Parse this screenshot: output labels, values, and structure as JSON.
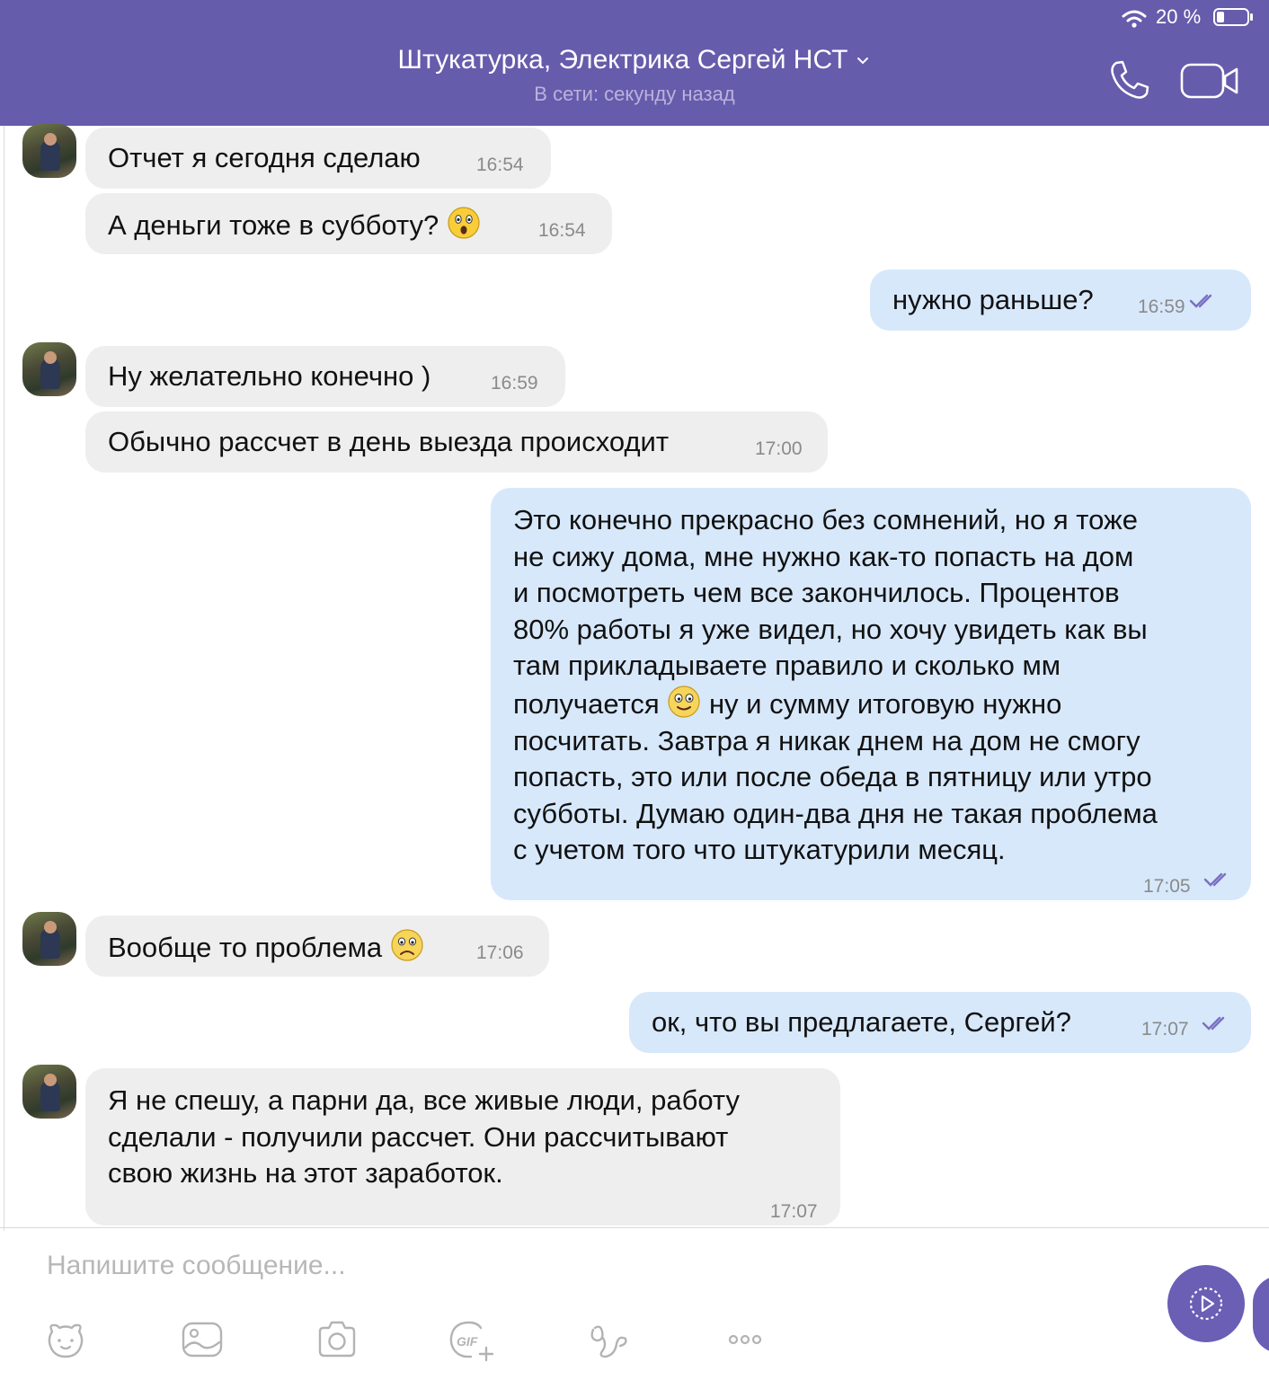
{
  "status_bar": {
    "battery_percent": "20 %",
    "battery_level": 0.2
  },
  "header": {
    "title": "Штукатурка, Электрика Сергей НСТ",
    "subtitle": "В сети: секунду назад",
    "icons": [
      "chevron-down-icon",
      "phone-icon",
      "video-camera-icon"
    ]
  },
  "messages": [
    {
      "dir": "in",
      "text": "Отчет я сегодня сделаю",
      "time": "16:54"
    },
    {
      "dir": "in",
      "text": "А деньги тоже в субботу?",
      "emoji": "astonished-face-emoji",
      "time": "16:54"
    },
    {
      "dir": "out",
      "text": "нужно раньше?",
      "time": "16:59",
      "status": "read"
    },
    {
      "dir": "in",
      "text": "Ну желательно конечно )",
      "time": "16:59"
    },
    {
      "dir": "in",
      "text": "Обычно рассчет в день выезда происходит",
      "time": "17:00"
    },
    {
      "dir": "out",
      "lines": [
        "Это конечно прекрасно без сомнений, но я тоже",
        "не сижу дома, мне нужно как-то попасть на дом",
        "и посмотреть чем все закончилось. Процентов",
        "80% работы я уже видел, но хочу увидеть как вы",
        "там прикладываете правило и сколько мм",
        "получается",
        "ну и сумму итоговую нужно",
        "посчитать. Завтра я никак днем на дом не смогу",
        "попасть, это или после обеда в пятницу или утро",
        "субботы. Думаю один-два дня не такая проблема",
        "с учетом того что штукатурили месяц."
      ],
      "emoji": "slightly-smiling-face-emoji",
      "time": "17:05",
      "status": "read"
    },
    {
      "dir": "in",
      "text": "Вообще то проблема",
      "emoji": "frowning-face-emoji",
      "time": "17:06"
    },
    {
      "dir": "out",
      "text": "ок, что вы предлагаете, Сергей?",
      "time": "17:07",
      "status": "read"
    },
    {
      "dir": "in",
      "lines": [
        "Я не спешу, а парни да, все живые люди, работу",
        "сделали - получили рассчет. Они рассчитывают",
        "свою жизнь на этот заработок."
      ],
      "time": "17:07"
    }
  ],
  "input": {
    "placeholder": "Напишите сообщение...",
    "toolbar_icons": [
      "sticker-icon",
      "gallery-icon",
      "camera-icon",
      "gif-icon",
      "doodle-icon",
      "more-icon"
    ],
    "gif_label": "GIF",
    "send_icon": "play-icon"
  },
  "colors": {
    "header": "#665cac",
    "incoming_bubble": "#eeeeee",
    "outgoing_bubble": "#d7e8fb",
    "accent": "#6a5fb5",
    "read_ticks": "#7a6fc4"
  }
}
